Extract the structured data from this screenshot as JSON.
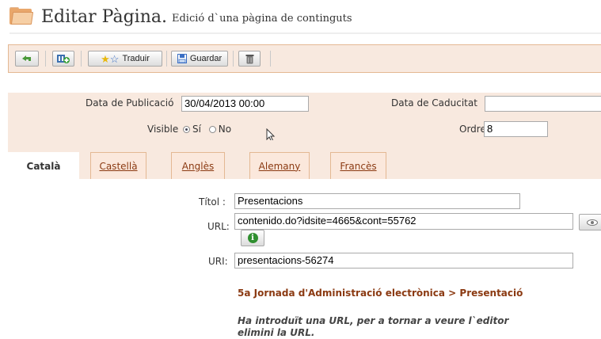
{
  "header": {
    "icon": "folder-icon",
    "title": "Editar Pàgina.",
    "subtitle": "Edició d`una pàgina de continguts"
  },
  "toolbar": {
    "undo_icon": "undo-icon",
    "add_icon": "add-module-icon",
    "translate_label": "Traduir",
    "translate_icon": "stars-icon",
    "save_label": "Guardar",
    "save_icon": "save-disk-icon",
    "delete_icon": "trash-icon"
  },
  "form": {
    "publication_label": "Data de Publicació",
    "publication_value": "30/04/2013 00:00",
    "expiry_label": "Data de Caducitat",
    "expiry_value": "",
    "visible_label": "Visible",
    "visible_yes": "Sí",
    "visible_no": "No",
    "visible_selected": "Sí",
    "order_label": "Ordre",
    "order_value": "8"
  },
  "tabs": [
    {
      "label": "Català",
      "active": true
    },
    {
      "label": "Castellà",
      "active": false
    },
    {
      "label": "Anglès",
      "active": false
    },
    {
      "label": "Alemany",
      "active": false
    },
    {
      "label": "Francès",
      "active": false
    }
  ],
  "content": {
    "title_label": "Títol :",
    "title_value": "Presentacions",
    "url_label": "URL:",
    "url_value": "contenido.do?idsite=4665&cont=55762",
    "uri_label": "URI:",
    "uri_value": "presentacions-56274",
    "breadcrumb": "5a Jornada d'Administració electrònica > Presentació",
    "note_line1": "Ha introduït una URL, per a tornar a veure l`editor",
    "note_line2": "elimini la URL."
  },
  "colors": {
    "accent": "#8b3a12",
    "panel_bg": "#f8e9df",
    "border": "#e4b893"
  }
}
